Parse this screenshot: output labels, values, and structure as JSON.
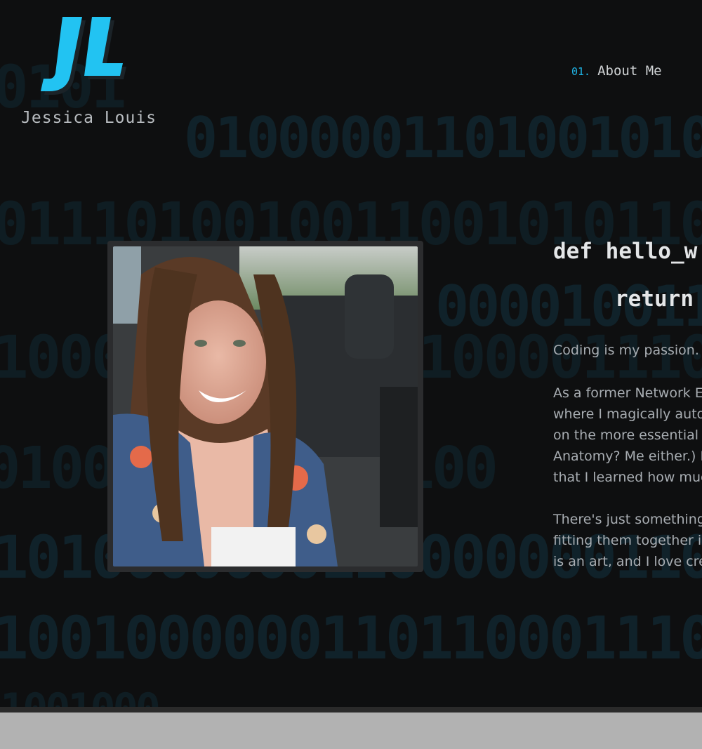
{
  "brand": {
    "name": "Jessica Louis",
    "logo_text": "JL"
  },
  "nav": {
    "items": [
      {
        "number": "01.",
        "label": "About Me"
      }
    ]
  },
  "hero": {
    "code": {
      "line1": "def hello_w",
      "line2": "return"
    },
    "paragraph1": "Coding is my passion.",
    "paragraph2": [
      "As a former Network En",
      "where I magically auton",
      "on the more essential th",
      "Anatomy? Me either.) It",
      "that I learned how much"
    ],
    "paragraph3": [
      "There's just something",
      "fitting them together in",
      "is an art, and I love crea"
    ],
    "photo_alt": "portrait-photo"
  },
  "background_binary": [
    "0101",
    "01000001101001010",
    "0111010010011001010110111",
    "0000100110",
    "1000000001110100001110",
    "0100001110010100",
    "10100000001100000001100",
    "1001000000110110001110",
    "1001000"
  ],
  "colors": {
    "accent": "#1fb6e8",
    "background": "#0e0f10",
    "text": "#e4e6e8",
    "muted": "#a8adb2"
  }
}
